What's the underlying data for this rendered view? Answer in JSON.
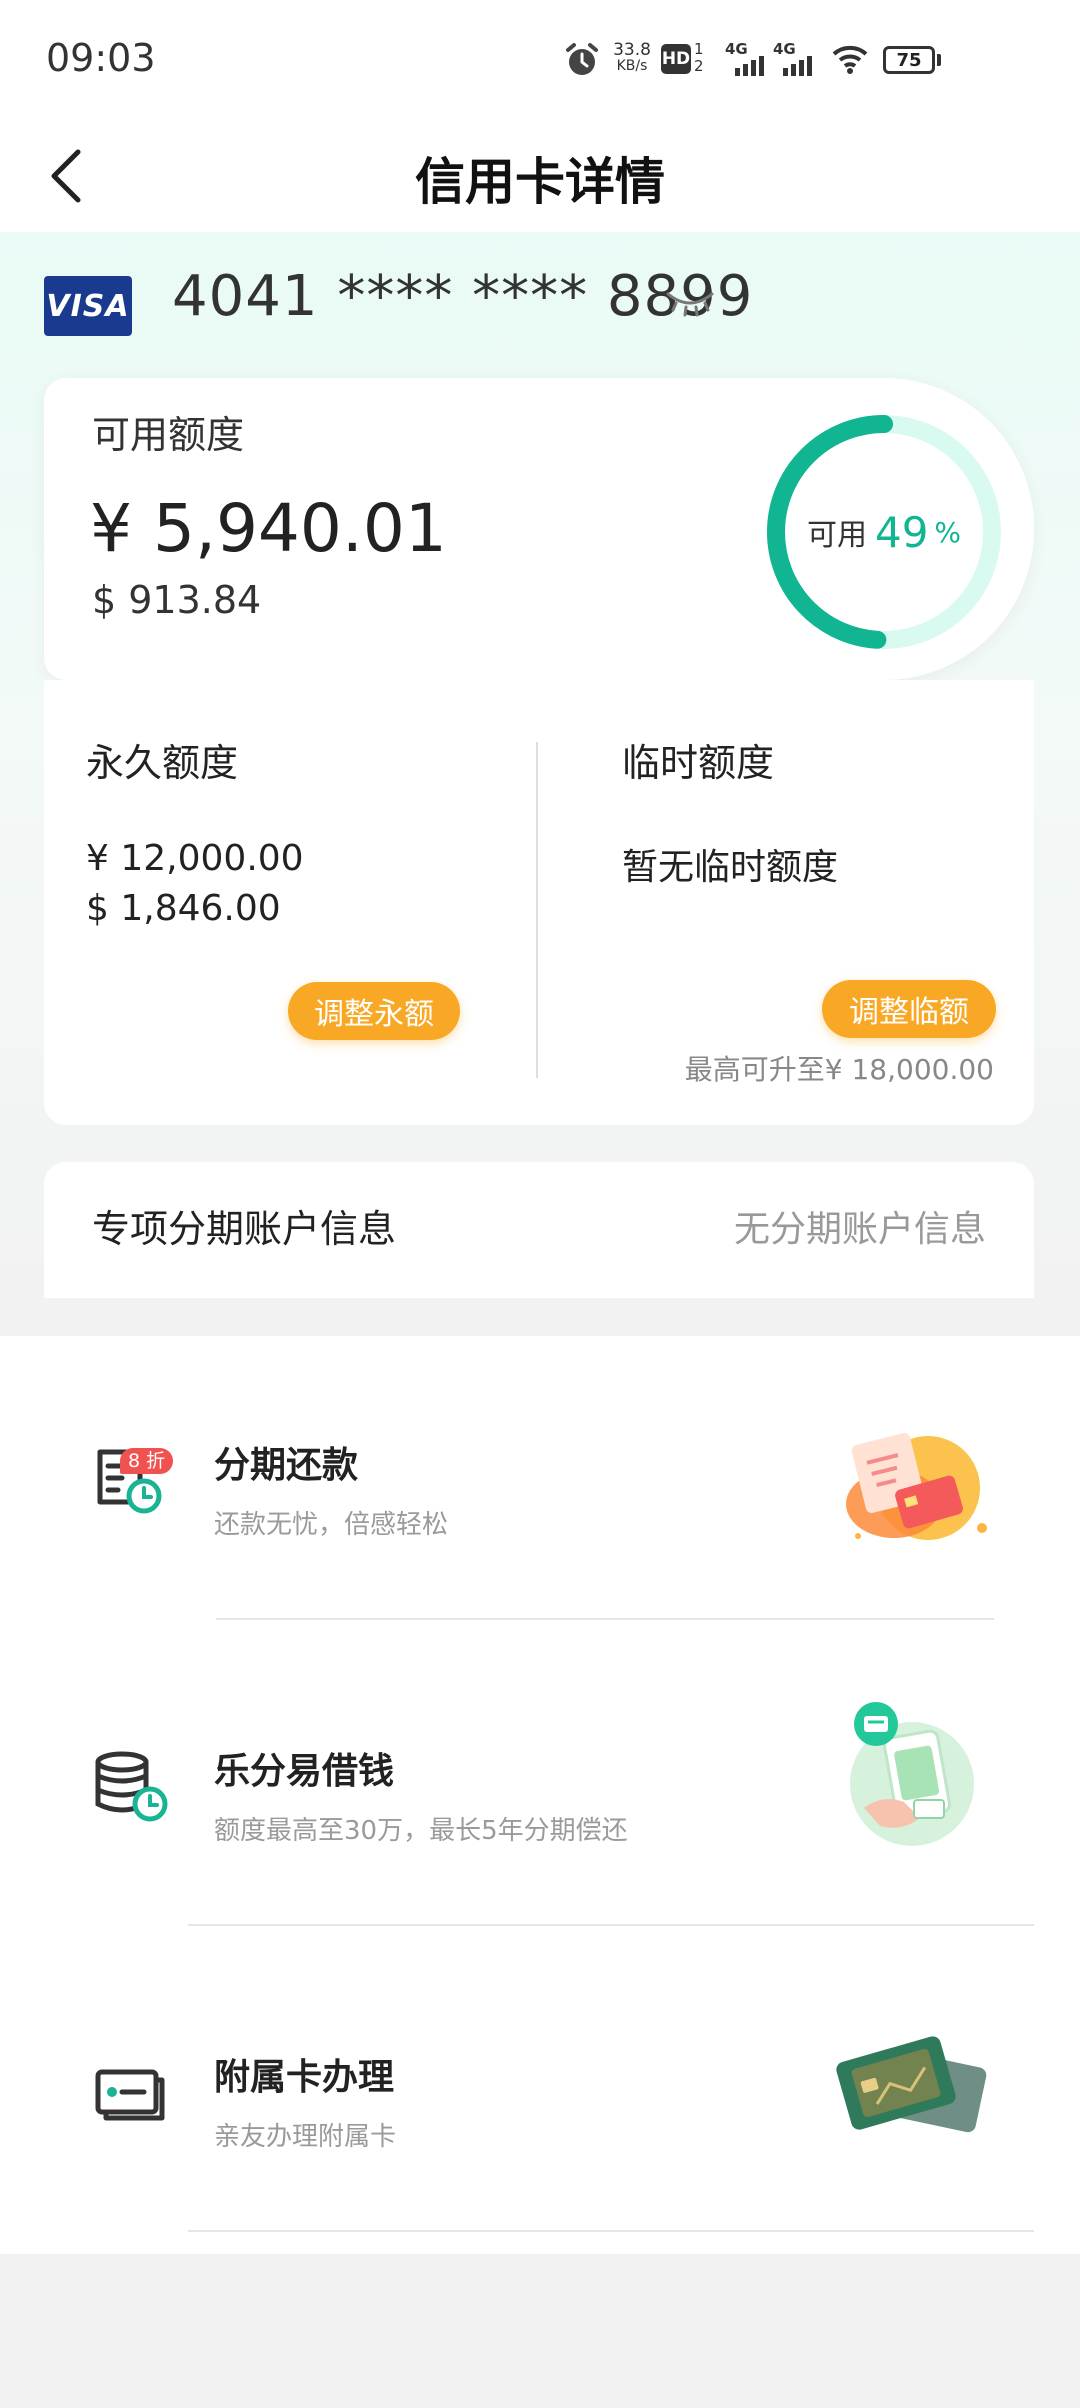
{
  "status_bar": {
    "time": "09:03",
    "net_speed_value": "33.8",
    "net_speed_unit": "KB/s",
    "hd_label": "HD",
    "sim1": "1",
    "sim2": "2",
    "network1": "4G",
    "network2": "4G",
    "battery": "75",
    "battery_level": 0.75
  },
  "header": {
    "title": "信用卡详情"
  },
  "card": {
    "brand": "VISA",
    "number": "4041 **** **** 8899"
  },
  "available": {
    "label": "可用额度",
    "cny": "¥ 5,940.01",
    "usd": "$ 913.84",
    "ring_label": "可用",
    "ring_value": "49",
    "ring_unit": "%",
    "ring_fraction": 0.49,
    "accent_color": "#11b591",
    "track_color": "#d9faf0"
  },
  "permanent": {
    "title": "永久额度",
    "cny": "¥ 12,000.00",
    "usd": "$ 1,846.00",
    "button": "调整永额"
  },
  "temporary": {
    "title": "临时额度",
    "none_text": "暂无临时额度",
    "button": "调整临额",
    "max_text": "最高可升至¥ 18,000.00"
  },
  "installment_account": {
    "label": "专项分期账户信息",
    "value": "无分期账户信息"
  },
  "services": [
    {
      "title": "分期还款",
      "subtitle": "还款无忧，倍感轻松",
      "badge": "8 折",
      "icon": "installment-bill-icon"
    },
    {
      "title": "乐分易借钱",
      "subtitle": "额度最高至30万，最长5年分期偿还",
      "icon": "coins-clock-icon"
    },
    {
      "title": "附属卡办理",
      "subtitle": "亲友办理附属卡",
      "icon": "card-icon"
    }
  ],
  "colors": {
    "pill": "#f9a825",
    "accent": "#11b591"
  }
}
